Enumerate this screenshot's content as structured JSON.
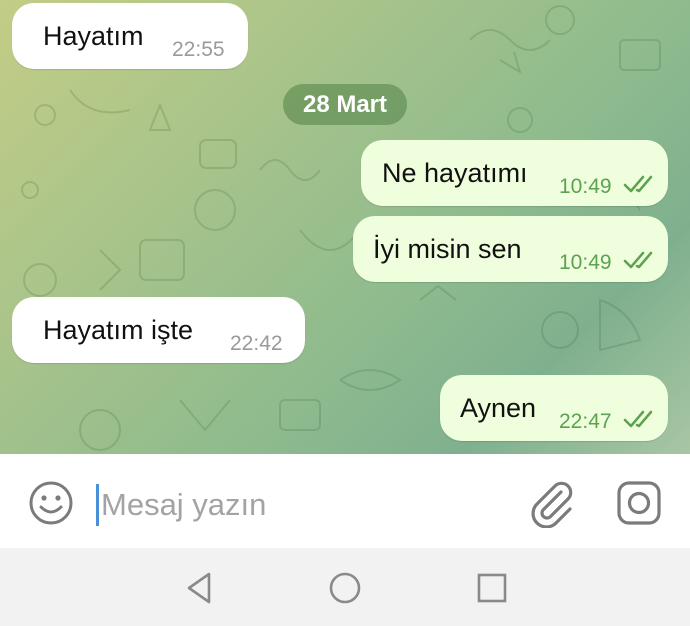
{
  "chat": {
    "date_separator": "28 Mart",
    "messages": [
      {
        "direction": "incoming",
        "text": "Hayatım",
        "time": "22:55"
      },
      {
        "direction": "outgoing",
        "text": "Ne hayatımı",
        "time": "10:49",
        "status": "read"
      },
      {
        "direction": "outgoing",
        "text": "İyi misin sen",
        "time": "10:49",
        "status": "read"
      },
      {
        "direction": "incoming",
        "text": "Hayatım işte",
        "time": "22:42"
      },
      {
        "direction": "outgoing",
        "text": "Aynen",
        "time": "22:47",
        "status": "read"
      }
    ]
  },
  "composer": {
    "placeholder": "Mesaj yazın",
    "emoji_icon": "smiley-icon",
    "attach_icon": "paperclip-icon",
    "camera_icon": "camera-icon"
  },
  "navigation": {
    "back_icon": "back-triangle-icon",
    "home_icon": "home-circle-icon",
    "recents_icon": "recents-square-icon"
  },
  "colors": {
    "incoming_bubble": "#ffffff",
    "outgoing_bubble": "#effedd",
    "outgoing_time": "#5da24f",
    "read_ticks": "#5da24f",
    "date_pill": "#6f9a62"
  }
}
